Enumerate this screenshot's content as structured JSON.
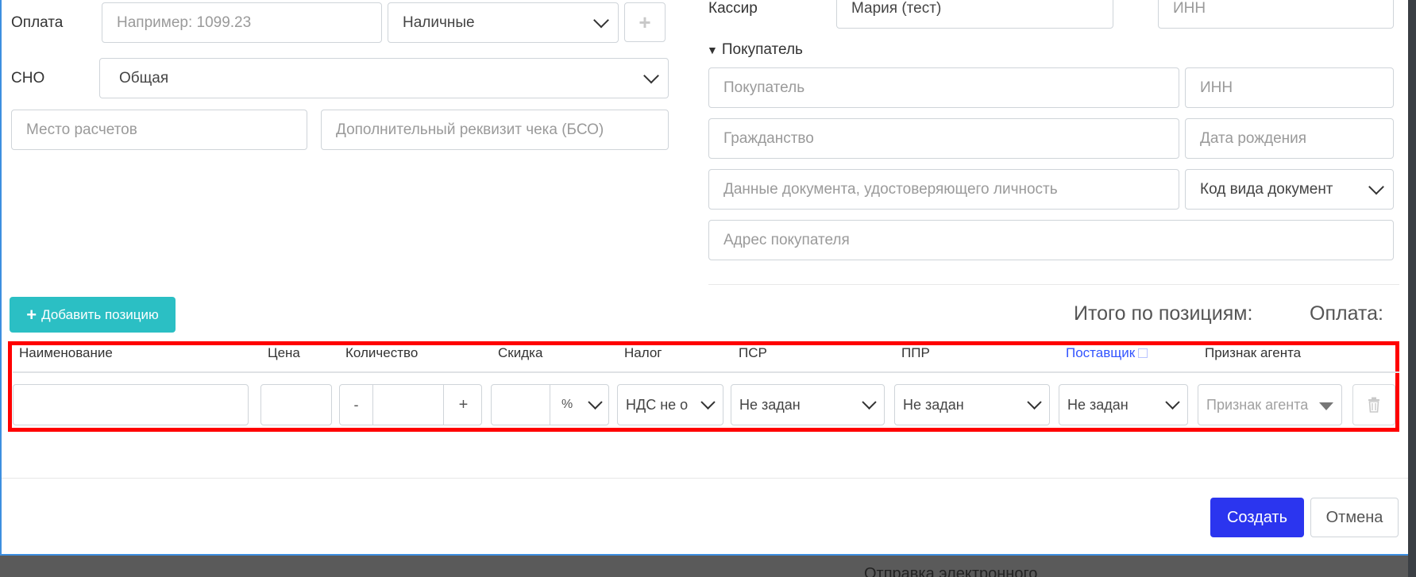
{
  "payment": {
    "label": "Оплата",
    "amount_placeholder": "Например: 1099.23",
    "method_value": "Наличные",
    "add_label": "+"
  },
  "sno": {
    "label": "СНО",
    "value": "Общая"
  },
  "settlement_place_placeholder": "Место расчетов",
  "extra_requisite_placeholder": "Дополнительный реквизит чека (БСО)",
  "cashier": {
    "label": "Кассир",
    "name_value": "Мария (тест)",
    "inn_placeholder": "ИНН"
  },
  "buyer": {
    "section_label": "Покупатель",
    "name_placeholder": "Покупатель",
    "inn_placeholder": "ИНН",
    "citizenship_placeholder": "Гражданство",
    "birthdate_placeholder": "Дата рождения",
    "id_document_placeholder": "Данные документа, удостоверяющего личность",
    "doc_type_value": "Код вида документ",
    "address_placeholder": "Адрес покупателя"
  },
  "add_position_label": "Добавить позицию",
  "totals": {
    "positions_label": "Итого по позициям:",
    "payment_label": "Оплата:"
  },
  "table": {
    "headers": {
      "name": "Наименование",
      "price": "Цена",
      "quantity": "Количество",
      "discount": "Скидка",
      "tax": "Налог",
      "psr": "ПСР",
      "ppr": "ППР",
      "supplier": "Поставщик",
      "agent_sign": "Признак агента"
    },
    "row": {
      "qty_minus": "-",
      "qty_plus": "+",
      "discount_unit": "%",
      "tax_value": "НДС не о",
      "psr_value": "Не задан",
      "ppr_value": "Не задан",
      "supplier_value": "Не задан",
      "agent_placeholder": "Признак агента"
    }
  },
  "footer": {
    "create_label": "Создать",
    "cancel_label": "Отмена"
  },
  "background_text": "Отправка электронного"
}
